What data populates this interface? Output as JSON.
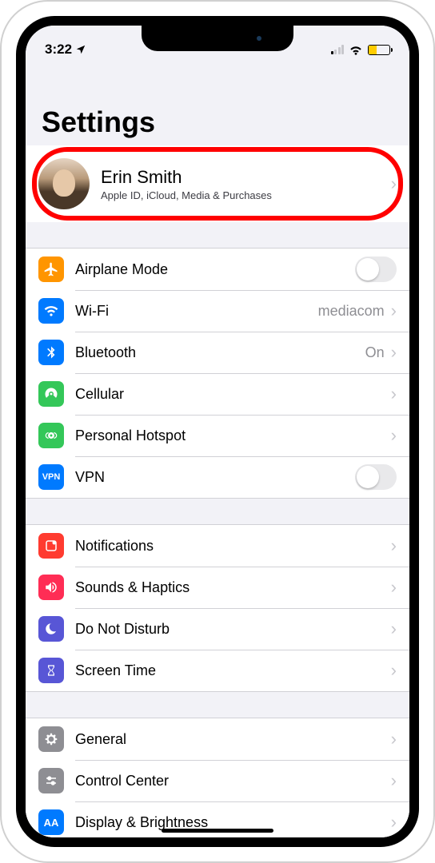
{
  "status": {
    "time": "3:22",
    "location_icon": "➤"
  },
  "title": "Settings",
  "profile": {
    "name": "Erin Smith",
    "subtitle": "Apple ID, iCloud, Media & Purchases"
  },
  "group_network": [
    {
      "id": "airplane",
      "label": "Airplane Mode",
      "color": "#ff9500",
      "kind": "toggle",
      "value": "off"
    },
    {
      "id": "wifi",
      "label": "Wi-Fi",
      "color": "#007aff",
      "kind": "drill",
      "value": "mediacom"
    },
    {
      "id": "bluetooth",
      "label": "Bluetooth",
      "color": "#007aff",
      "kind": "drill",
      "value": "On"
    },
    {
      "id": "cellular",
      "label": "Cellular",
      "color": "#34c759",
      "kind": "drill",
      "value": ""
    },
    {
      "id": "hotspot",
      "label": "Personal Hotspot",
      "color": "#34c759",
      "kind": "drill",
      "value": ""
    },
    {
      "id": "vpn",
      "label": "VPN",
      "color": "#007aff",
      "kind": "toggle",
      "value": "off",
      "icon_text": "VPN"
    }
  ],
  "group_alerts": [
    {
      "id": "notifications",
      "label": "Notifications",
      "color": "#ff3b30"
    },
    {
      "id": "sounds",
      "label": "Sounds & Haptics",
      "color": "#ff2d55"
    },
    {
      "id": "dnd",
      "label": "Do Not Disturb",
      "color": "#5856d6"
    },
    {
      "id": "screentime",
      "label": "Screen Time",
      "color": "#5856d6"
    }
  ],
  "group_general": [
    {
      "id": "general",
      "label": "General",
      "color": "#8e8e93"
    },
    {
      "id": "controlcenter",
      "label": "Control Center",
      "color": "#8e8e93"
    },
    {
      "id": "display",
      "label": "Display & Brightness",
      "color": "#007aff",
      "icon_text": "AA"
    }
  ]
}
